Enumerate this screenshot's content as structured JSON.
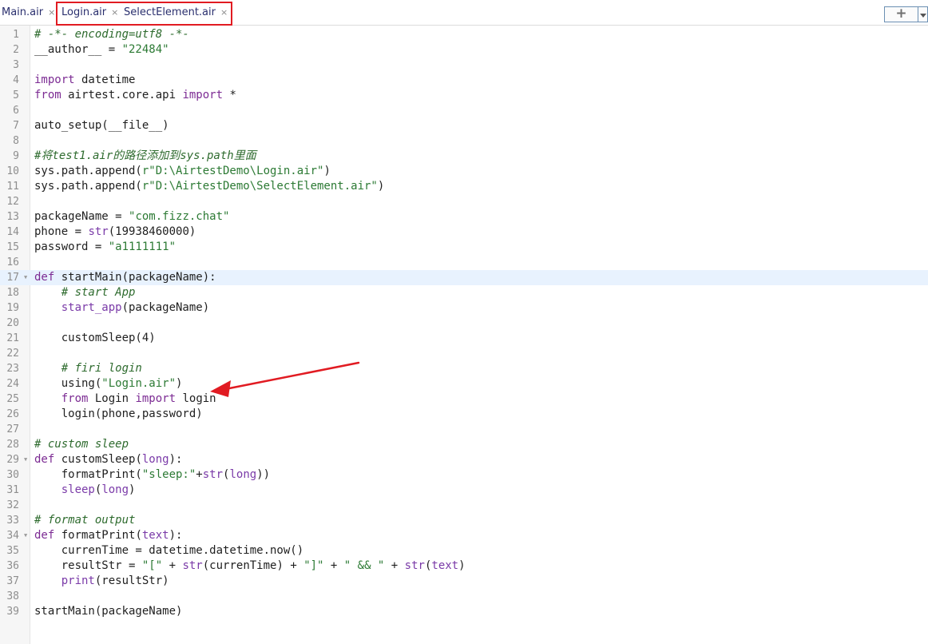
{
  "tabs": [
    {
      "label": "Main.air",
      "close": "×"
    },
    {
      "label": "Login.air",
      "close": "×"
    },
    {
      "label": "SelectElement.air",
      "close": "×"
    }
  ],
  "tab_add_label": "+",
  "colors": {
    "highlight_box": "#e11b22",
    "arrow": "#e11b22",
    "current_line": "#e8f2fe"
  },
  "editor": {
    "current_line": 17,
    "fold_marker_lines": [
      17,
      29,
      34
    ],
    "lines": [
      {
        "n": "1",
        "tokens": [
          {
            "t": "# -*- encoding=utf8 -*-",
            "c": "cm"
          }
        ]
      },
      {
        "n": "2",
        "tokens": [
          {
            "t": "__author__ = ",
            "c": ""
          },
          {
            "t": "\"22484\"",
            "c": "str"
          }
        ]
      },
      {
        "n": "3",
        "tokens": []
      },
      {
        "n": "4",
        "tokens": [
          {
            "t": "import",
            "c": "kw"
          },
          {
            "t": " datetime",
            "c": ""
          }
        ]
      },
      {
        "n": "5",
        "tokens": [
          {
            "t": "from",
            "c": "kw"
          },
          {
            "t": " airtest.core.api ",
            "c": ""
          },
          {
            "t": "import",
            "c": "kw"
          },
          {
            "t": " *",
            "c": ""
          }
        ]
      },
      {
        "n": "6",
        "tokens": []
      },
      {
        "n": "7",
        "tokens": [
          {
            "t": "auto_setup(__file__)",
            "c": ""
          }
        ]
      },
      {
        "n": "8",
        "tokens": []
      },
      {
        "n": "9",
        "tokens": [
          {
            "t": "#将test1.air的路径添加到sys.path里面",
            "c": "cm"
          }
        ]
      },
      {
        "n": "10",
        "tokens": [
          {
            "t": "sys.path.append(",
            "c": ""
          },
          {
            "t": "r\"D:\\AirtestDemo\\Login.air\"",
            "c": "str"
          },
          {
            "t": ")",
            "c": ""
          }
        ]
      },
      {
        "n": "11",
        "tokens": [
          {
            "t": "sys.path.append(",
            "c": ""
          },
          {
            "t": "r\"D:\\AirtestDemo\\SelectElement.air\"",
            "c": "str"
          },
          {
            "t": ")",
            "c": ""
          }
        ]
      },
      {
        "n": "12",
        "tokens": []
      },
      {
        "n": "13",
        "tokens": [
          {
            "t": "packageName = ",
            "c": ""
          },
          {
            "t": "\"com.fizz.chat\"",
            "c": "str"
          }
        ]
      },
      {
        "n": "14",
        "tokens": [
          {
            "t": "phone = ",
            "c": ""
          },
          {
            "t": "str",
            "c": "bi"
          },
          {
            "t": "(19938460000)",
            "c": ""
          }
        ]
      },
      {
        "n": "15",
        "tokens": [
          {
            "t": "password = ",
            "c": ""
          },
          {
            "t": "\"a1111111\"",
            "c": "str"
          }
        ]
      },
      {
        "n": "16",
        "tokens": []
      },
      {
        "n": "17",
        "tokens": [
          {
            "t": "def",
            "c": "kw"
          },
          {
            "t": " startMain(packageName):",
            "c": ""
          }
        ]
      },
      {
        "n": "18",
        "tokens": [
          {
            "t": "    ",
            "c": ""
          },
          {
            "t": "# start App",
            "c": "cm"
          }
        ]
      },
      {
        "n": "19",
        "tokens": [
          {
            "t": "    ",
            "c": ""
          },
          {
            "t": "start_app",
            "c": "bi"
          },
          {
            "t": "(packageName)",
            "c": ""
          }
        ]
      },
      {
        "n": "20",
        "tokens": []
      },
      {
        "n": "21",
        "tokens": [
          {
            "t": "    customSleep(4)",
            "c": ""
          }
        ]
      },
      {
        "n": "22",
        "tokens": []
      },
      {
        "n": "23",
        "tokens": [
          {
            "t": "    ",
            "c": ""
          },
          {
            "t": "# firi login",
            "c": "cm"
          }
        ]
      },
      {
        "n": "24",
        "tokens": [
          {
            "t": "    using(",
            "c": ""
          },
          {
            "t": "\"Login.air\"",
            "c": "str"
          },
          {
            "t": ")",
            "c": ""
          }
        ]
      },
      {
        "n": "25",
        "tokens": [
          {
            "t": "    ",
            "c": ""
          },
          {
            "t": "from",
            "c": "kw"
          },
          {
            "t": " Login ",
            "c": ""
          },
          {
            "t": "import",
            "c": "kw"
          },
          {
            "t": " login",
            "c": ""
          }
        ]
      },
      {
        "n": "26",
        "tokens": [
          {
            "t": "    login(phone,password)",
            "c": ""
          }
        ]
      },
      {
        "n": "27",
        "tokens": []
      },
      {
        "n": "28",
        "tokens": [
          {
            "t": "# custom sleep",
            "c": "cm"
          }
        ]
      },
      {
        "n": "29",
        "tokens": [
          {
            "t": "def",
            "c": "kw"
          },
          {
            "t": " customSleep(",
            "c": ""
          },
          {
            "t": "long",
            "c": "bi"
          },
          {
            "t": "):",
            "c": ""
          }
        ]
      },
      {
        "n": "30",
        "tokens": [
          {
            "t": "    formatPrint(",
            "c": ""
          },
          {
            "t": "\"sleep:\"",
            "c": "str"
          },
          {
            "t": "+",
            "c": ""
          },
          {
            "t": "str",
            "c": "bi"
          },
          {
            "t": "(",
            "c": ""
          },
          {
            "t": "long",
            "c": "bi"
          },
          {
            "t": "))",
            "c": ""
          }
        ]
      },
      {
        "n": "31",
        "tokens": [
          {
            "t": "    ",
            "c": ""
          },
          {
            "t": "sleep",
            "c": "bi"
          },
          {
            "t": "(",
            "c": ""
          },
          {
            "t": "long",
            "c": "bi"
          },
          {
            "t": ")",
            "c": ""
          }
        ]
      },
      {
        "n": "32",
        "tokens": []
      },
      {
        "n": "33",
        "tokens": [
          {
            "t": "# format output",
            "c": "cm"
          }
        ]
      },
      {
        "n": "34",
        "tokens": [
          {
            "t": "def",
            "c": "kw"
          },
          {
            "t": " formatPrint(",
            "c": ""
          },
          {
            "t": "text",
            "c": "bi"
          },
          {
            "t": "):",
            "c": ""
          }
        ]
      },
      {
        "n": "35",
        "tokens": [
          {
            "t": "    currenTime = datetime.datetime.now()",
            "c": ""
          }
        ]
      },
      {
        "n": "36",
        "tokens": [
          {
            "t": "    resultStr = ",
            "c": ""
          },
          {
            "t": "\"[\"",
            "c": "str"
          },
          {
            "t": " + ",
            "c": ""
          },
          {
            "t": "str",
            "c": "bi"
          },
          {
            "t": "(currenTime) + ",
            "c": ""
          },
          {
            "t": "\"]\"",
            "c": "str"
          },
          {
            "t": " + ",
            "c": ""
          },
          {
            "t": "\" && \"",
            "c": "str"
          },
          {
            "t": " + ",
            "c": ""
          },
          {
            "t": "str",
            "c": "bi"
          },
          {
            "t": "(",
            "c": ""
          },
          {
            "t": "text",
            "c": "bi"
          },
          {
            "t": ")",
            "c": ""
          }
        ]
      },
      {
        "n": "37",
        "tokens": [
          {
            "t": "    ",
            "c": ""
          },
          {
            "t": "print",
            "c": "bi"
          },
          {
            "t": "(resultStr)",
            "c": ""
          }
        ]
      },
      {
        "n": "38",
        "tokens": []
      },
      {
        "n": "39",
        "tokens": [
          {
            "t": "startMain(packageName)",
            "c": ""
          }
        ]
      }
    ]
  }
}
